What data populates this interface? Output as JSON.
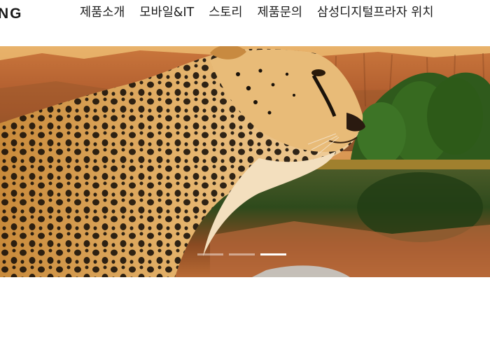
{
  "header": {
    "logo_text": "NG",
    "nav": [
      {
        "label": "제품소개"
      },
      {
        "label": "모바일&IT"
      },
      {
        "label": "스토리"
      },
      {
        "label": "제품문의"
      },
      {
        "label": "삼성디지털프라자 위치"
      }
    ]
  },
  "hero": {
    "slides": 3,
    "active_slide": 3
  },
  "colors": {
    "text": "#1c1c1c",
    "indicator_active": "#ffffff"
  }
}
